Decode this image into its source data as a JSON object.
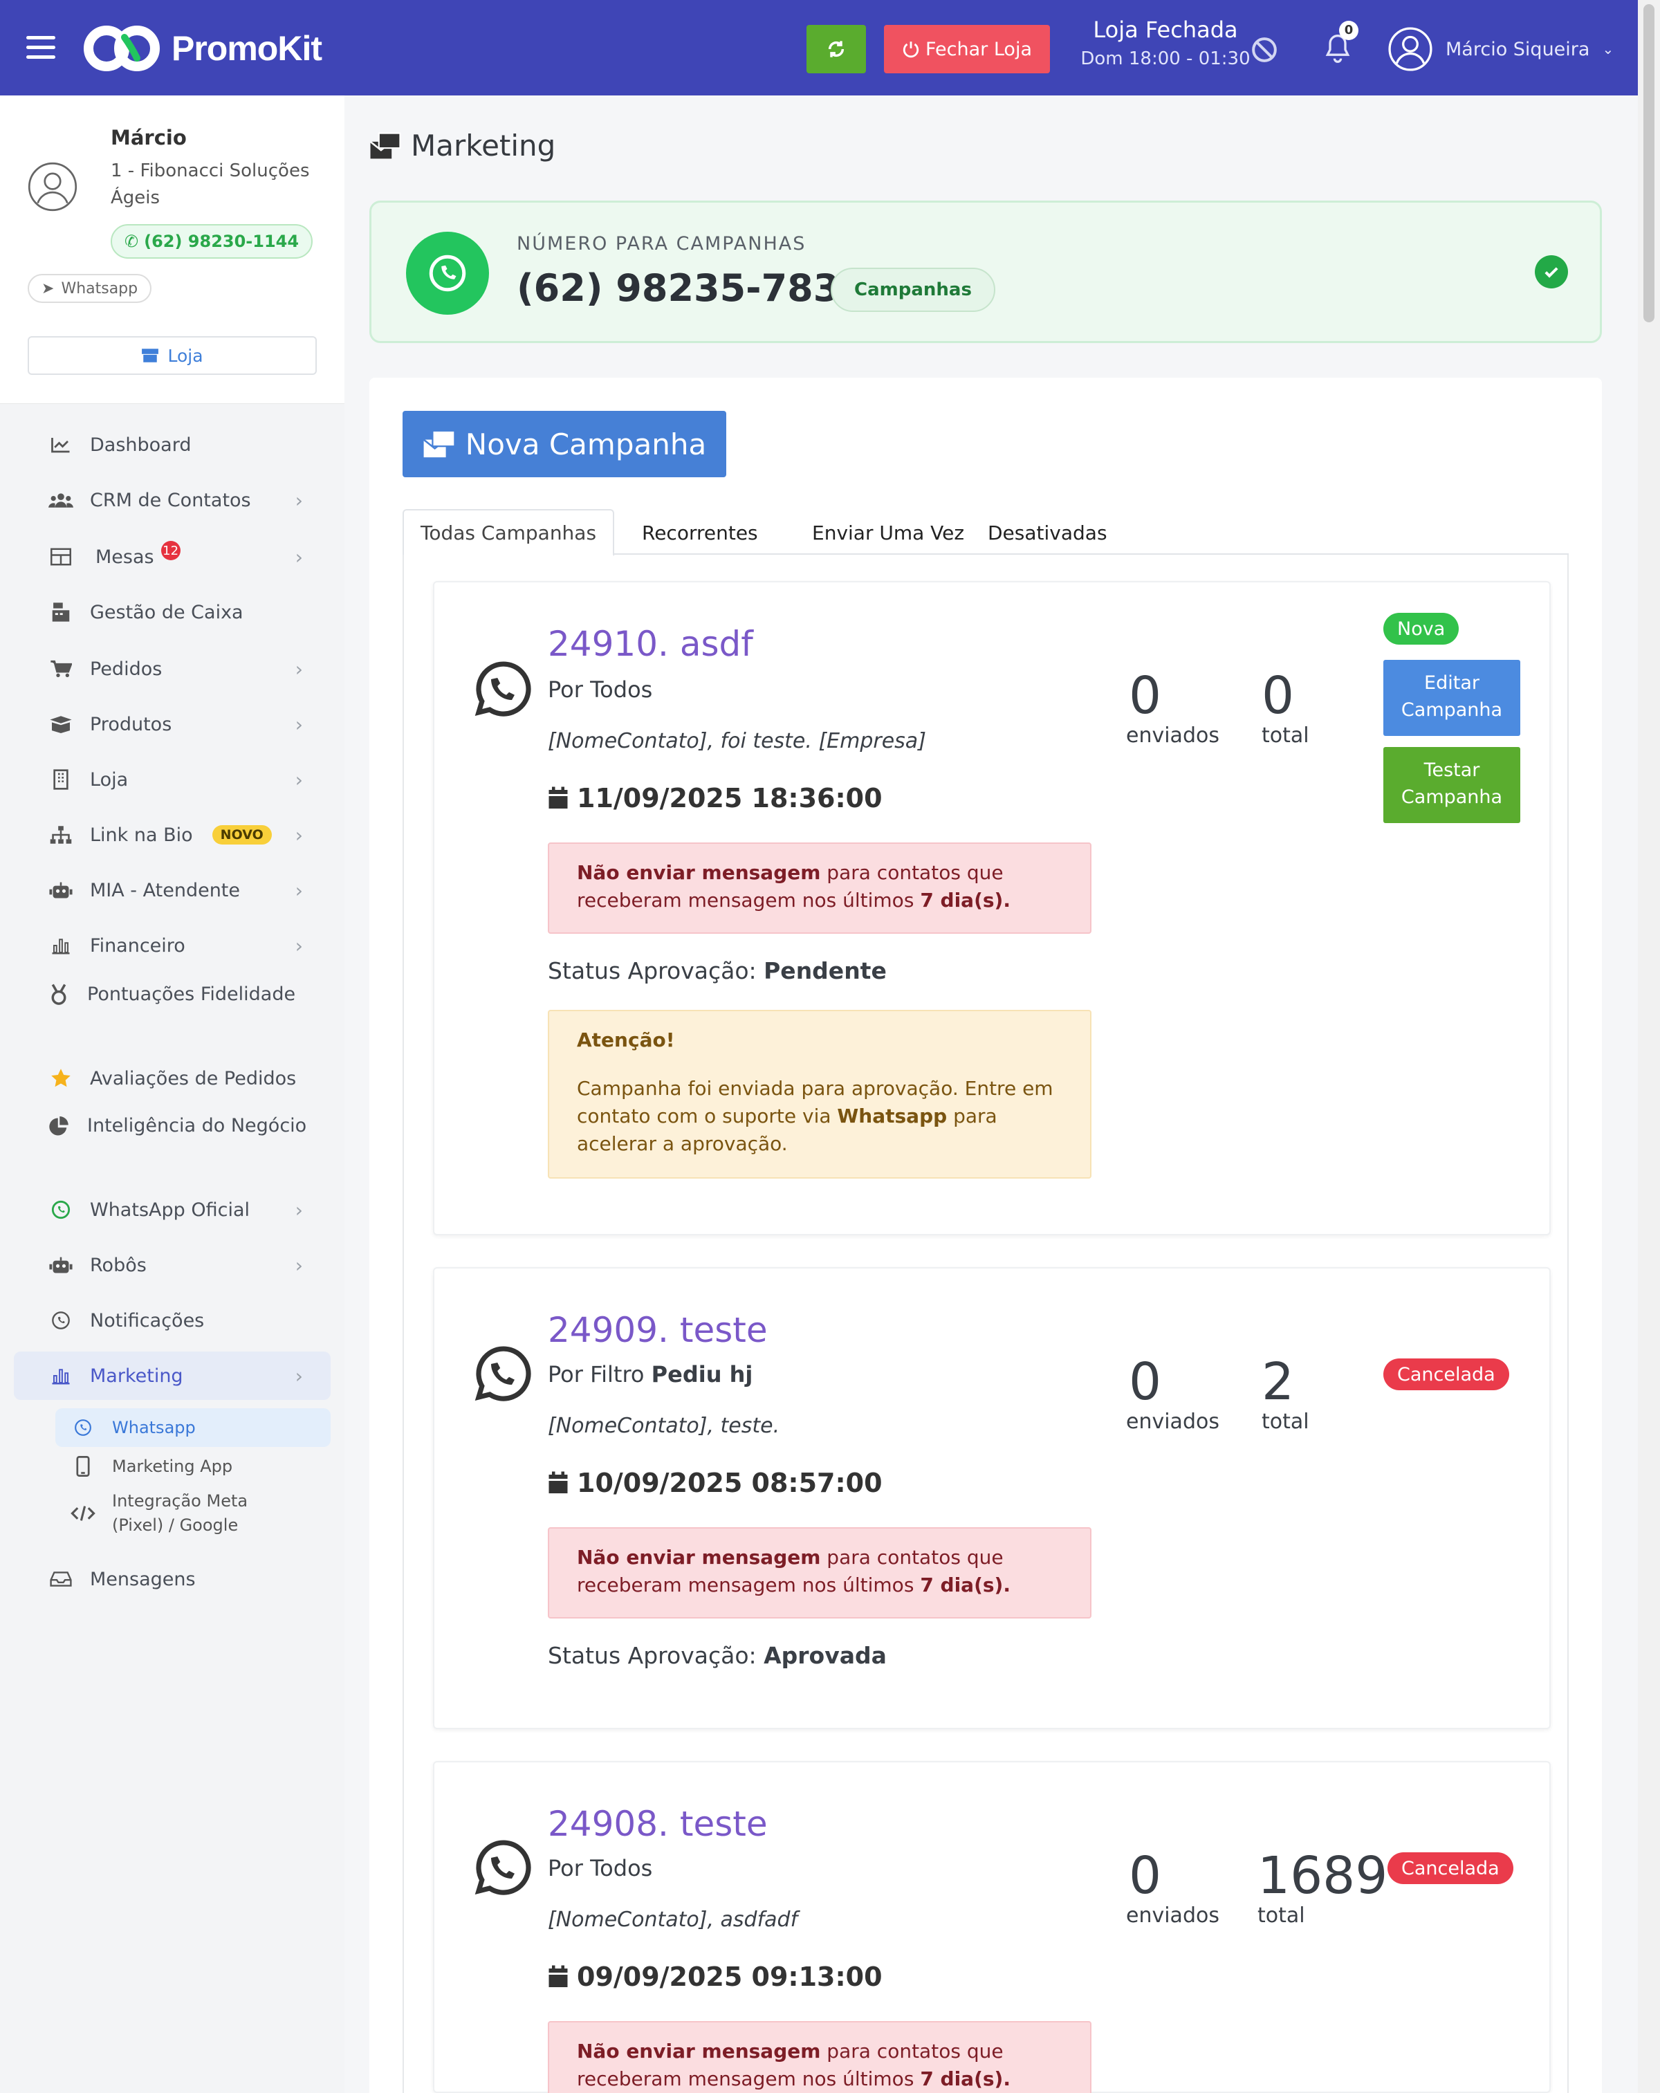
{
  "header": {
    "brand": "PromoKit",
    "close_store_label": "Fechar Loja",
    "store_status": "Loja Fechada",
    "store_hours": "Dom 18:00 - 01:30",
    "notification_count": "0",
    "user_name": "Márcio Siqueira",
    "colors": {
      "bar": "#3f45b6",
      "refresh": "#5aac2e",
      "close": "#f05260"
    }
  },
  "profile": {
    "name": "Márcio",
    "company": "1 - Fibonacci Soluções Ágeis",
    "phone": "(62) 98230-1144",
    "channel": "Whatsapp",
    "store_button": "Loja"
  },
  "sidebar": {
    "items": [
      {
        "label": "Dashboard",
        "icon": "chart-line-icon"
      },
      {
        "label": "CRM de Contatos",
        "icon": "users-icon"
      },
      {
        "label": "Mesas",
        "icon": "table-icon",
        "badge": "12"
      },
      {
        "label": "Gestão de Caixa",
        "icon": "cash-register-icon"
      },
      {
        "label": "Pedidos",
        "icon": "cart-icon"
      },
      {
        "label": "Produtos",
        "icon": "box-icon"
      },
      {
        "label": "Loja",
        "icon": "building-icon"
      },
      {
        "label": "Link na Bio",
        "icon": "sitemap-icon",
        "badge": "NOVO"
      },
      {
        "label": "MIA - Atendente",
        "icon": "robot-icon"
      },
      {
        "label": "Financeiro",
        "icon": "bar-chart-icon"
      },
      {
        "label": "Pontuações Fidelidade",
        "icon": "medal-icon"
      },
      {
        "label": "Avaliações de Pedidos",
        "icon": "star-icon"
      },
      {
        "label": "Inteligência do Negócio",
        "icon": "pie-chart-icon"
      },
      {
        "label": "WhatsApp Oficial",
        "icon": "whatsapp-icon"
      },
      {
        "label": "Robôs",
        "icon": "robot-icon"
      },
      {
        "label": "Notificações",
        "icon": "whatsapp-icon"
      },
      {
        "label": "Marketing",
        "icon": "bar-chart-icon"
      },
      {
        "label": "Mensagens",
        "icon": "inbox-icon"
      }
    ],
    "marketing_sub": [
      {
        "label": "Whatsapp"
      },
      {
        "label": "Marketing App"
      },
      {
        "label": "Integração Meta (Pixel) / Google"
      }
    ]
  },
  "main": {
    "page_title": "Marketing",
    "number_card": {
      "label": "NÚMERO PARA CAMPANHAS",
      "number": "(62) 98235-7834",
      "pill": "Campanhas"
    },
    "new_campaign_label": "Nova Campanha",
    "tabs": [
      "Todas Campanhas",
      "Recorrentes",
      "Enviar Uma Vez",
      "Desativadas"
    ],
    "campaigns": [
      {
        "title": "24910. asdf",
        "audience": "Por Todos",
        "message": "[NomeContato], foi teste. [Empresa]",
        "date": "11/09/2025 18:36:00",
        "warn_bold": "Não enviar mensagem",
        "warn_text": " para contatos que receberam mensagem nos últimos ",
        "warn_days": "7 dia(s).",
        "status_prefix": "Status Aprovação: ",
        "status_value": "Pendente",
        "sent": "0",
        "sent_label": "enviados",
        "total": "0",
        "total_label": "total",
        "badge": "Nova",
        "edit_label": "Editar Campanha",
        "test_label": "Testar Campanha",
        "attention_title": "Atenção!",
        "attention_text_1": "Campanha foi enviada para aprovação. Entre em contato com o suporte via ",
        "attention_bold": "Whatsapp",
        "attention_text_2": " para acelerar a aprovação."
      },
      {
        "title": "24909. teste",
        "audience_prefix": "Por Filtro ",
        "audience_bold": "Pediu hj",
        "message": "[NomeContato], teste.",
        "date": "10/09/2025 08:57:00",
        "warn_bold": "Não enviar mensagem",
        "warn_text": " para contatos que receberam mensagem nos últimos ",
        "warn_days": "7 dia(s).",
        "status_prefix": "Status Aprovação: ",
        "status_value": "Aprovada",
        "sent": "0",
        "sent_label": "enviados",
        "total": "2",
        "total_label": "total",
        "badge": "Cancelada"
      },
      {
        "title": "24908. teste",
        "audience": "Por Todos",
        "message": "[NomeContato], asdfadf",
        "date": "09/09/2025 09:13:00",
        "warn_bold": "Não enviar mensagem",
        "warn_text": " para contatos que receberam mensagem nos últimos ",
        "warn_days": "7 dia(s).",
        "sent": "0",
        "sent_label": "enviados",
        "total": "1689",
        "total_label": "total",
        "badge": "Cancelada"
      }
    ]
  }
}
